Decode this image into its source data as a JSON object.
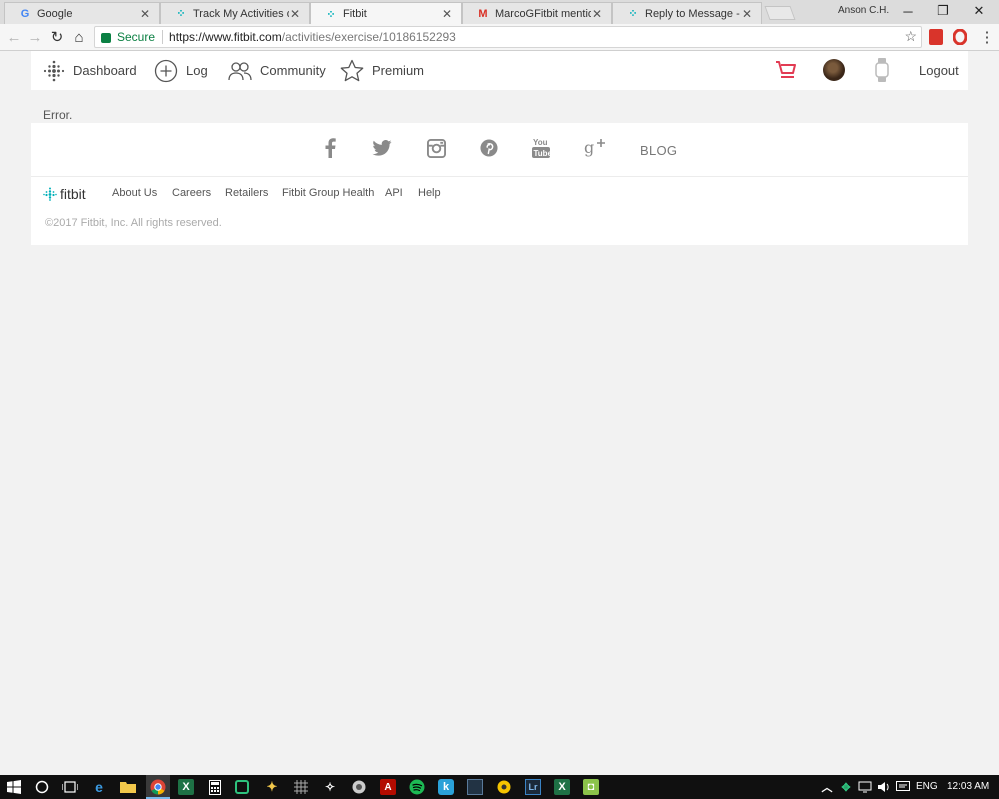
{
  "browser": {
    "tabs": [
      {
        "title": "Google",
        "favicon": "google-g-icon",
        "active": false
      },
      {
        "title": "Track My Activities on Fi",
        "favicon": "fitbit-dots-icon",
        "active": false
      },
      {
        "title": "Fitbit",
        "favicon": "fitbit-dots-icon",
        "active": true
      },
      {
        "title": "MarcoGFitbit mentioned",
        "favicon": "gmail-icon",
        "active": false
      },
      {
        "title": "Reply to Message - Fitbi",
        "favicon": "fitbit-dots-icon",
        "active": false
      }
    ],
    "window_user": "Anson C.H.",
    "address": {
      "secure_label": "Secure",
      "url_host": "https://www.fitbit.com",
      "url_path": "/activities/exercise/10186152293"
    }
  },
  "header": {
    "nav": [
      {
        "label": "Dashboard",
        "icon": "fitbit-logo-icon"
      },
      {
        "label": "Log",
        "icon": "plus-circle-icon"
      },
      {
        "label": "Community",
        "icon": "community-icon"
      },
      {
        "label": "Premium",
        "icon": "star-icon"
      }
    ],
    "logout_label": "Logout",
    "cart_color": "#e23b53"
  },
  "main": {
    "error_text": "Error."
  },
  "footer": {
    "social_icons": [
      "facebook-icon",
      "twitter-icon",
      "instagram-icon",
      "pinterest-icon",
      "youtube-icon",
      "google-plus-icon"
    ],
    "blog_label": "BLOG",
    "logo_text": "fitbit",
    "links": [
      "About Us",
      "Careers",
      "Retailers",
      "Fitbit Group Health",
      "API",
      "Help"
    ],
    "copyright": "©2017 Fitbit, Inc. All rights reserved.",
    "brand_color": "#00b0b9"
  },
  "taskbar": {
    "language": "ENG",
    "time": "12:03 AM"
  }
}
